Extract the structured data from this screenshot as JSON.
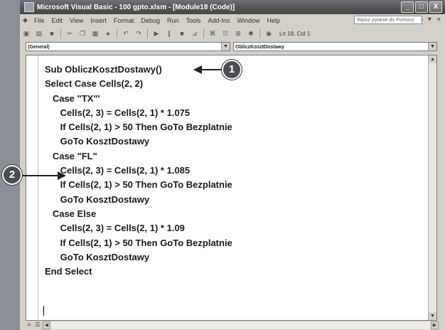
{
  "window": {
    "title": "Microsoft Visual Basic - 100 gpto.xlsm - [Module18 (Code)]",
    "controls": [
      "_",
      "□",
      "X"
    ]
  },
  "menu": {
    "items": [
      "File",
      "Edit",
      "View",
      "Insert",
      "Format",
      "Debug",
      "Run",
      "Tools",
      "Add-Ins",
      "Window",
      "Help"
    ],
    "help_placeholder": "Wpisz pytanie do Pomocy",
    "mdi_controls": "- ♂ ×"
  },
  "toolbar": {
    "position": "Ln 18, Col 1"
  },
  "combos": {
    "object": "(General)",
    "procedure": "ObliczKosztDostawy"
  },
  "code": {
    "lines": [
      "Sub ObliczKosztDostawy()",
      "Select Case Cells(2, 2)",
      "   Case \"TX\"'",
      "      Cells(2, 3) = Cells(2, 1) * 1.075",
      "      If Cells(2, 1) > 50 Then GoTo Bezplatnie",
      "      GoTo KosztDostawy",
      "   Case \"FL\"",
      "      Cells(2, 3) = Cells(2, 1) * 1.085",
      "      If Cells(2, 1) > 50 Then GoTo Bezplatnie",
      "      GoTo KosztDostawy",
      "   Case Else",
      "      Cells(2, 3) = Cells(2, 1) * 1.09",
      "      If Cells(2, 1) > 50 Then GoTo Bezplatnie",
      "      GoTo KosztDostawy",
      "End Select"
    ]
  },
  "callouts": [
    "1",
    "2"
  ]
}
